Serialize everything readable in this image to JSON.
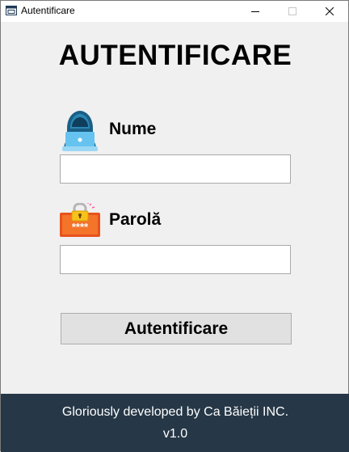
{
  "window": {
    "title": "Autentificare"
  },
  "form": {
    "heading": "AUTENTIFICARE",
    "name_label": "Nume",
    "name_value": "",
    "password_label": "Parolă",
    "password_value": "",
    "submit_label": "Autentificare"
  },
  "footer": {
    "credit": "Gloriously developed by Ca Băieții INC.",
    "version": "v1.0"
  },
  "icons": {
    "app": "window-icon",
    "user": "user-laptop-icon",
    "password": "password-lock-icon"
  },
  "colors": {
    "background": "#f0f0f0",
    "footer": "#263747",
    "button": "#e1e1e1"
  }
}
